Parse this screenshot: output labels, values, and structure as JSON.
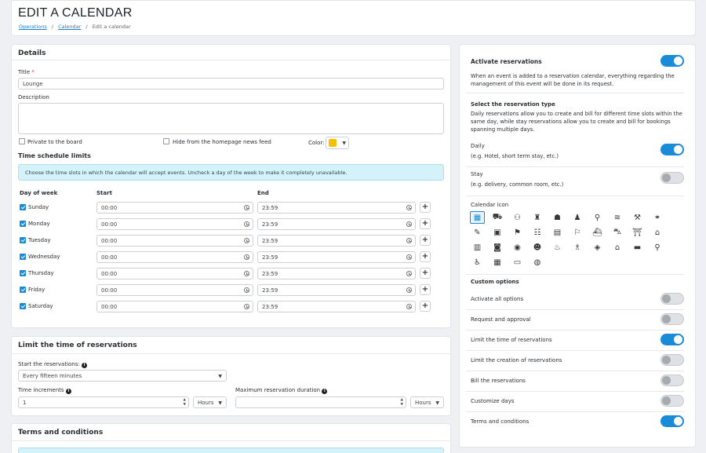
{
  "page": {
    "title": "EDIT A CALENDAR"
  },
  "breadcrumb": {
    "operations": "Operations",
    "calendar": "Calendar",
    "current": "Edit a calendar",
    "sep": "/"
  },
  "details": {
    "heading": "Details",
    "title_label": "Title",
    "required_mark": "*",
    "title_value": "Lounge",
    "description_label": "Description",
    "description_value": "",
    "private_label": "Private to the board",
    "hide_label": "Hide from the homepage news feed",
    "color_label": "Color:",
    "color_value": "#f6c000",
    "schedule_heading": "Time schedule limits",
    "schedule_info": "Choose the time slots in which the calendar will accept events. Uncheck a day of the week to make it completely unavailable.",
    "col_day": "Day of week",
    "col_start": "Start",
    "col_end": "End",
    "days": [
      {
        "name": "Sunday",
        "start": "00:00",
        "end": "23:59"
      },
      {
        "name": "Monday",
        "start": "00:00",
        "end": "23:59"
      },
      {
        "name": "Tuesday",
        "start": "00:00",
        "end": "23:59"
      },
      {
        "name": "Wednesday",
        "start": "00:00",
        "end": "23:59"
      },
      {
        "name": "Thursday",
        "start": "00:00",
        "end": "23:59"
      },
      {
        "name": "Friday",
        "start": "00:00",
        "end": "23:59"
      },
      {
        "name": "Saturday",
        "start": "00:00",
        "end": "23:59"
      }
    ],
    "plus": "+"
  },
  "limit": {
    "heading": "Limit the time of reservations",
    "start_label": "Start the reservations:",
    "start_value": "Every fifteen minutes",
    "increments_label": "Time increments",
    "increments_value": "1",
    "increments_unit": "Hours",
    "max_label": "Maximum reservation duration",
    "max_value": "",
    "max_unit": "Hours"
  },
  "terms": {
    "heading": "Terms and conditions"
  },
  "reservations": {
    "activate_label": "Activate reservations",
    "activate_on": true,
    "activate_desc": "When an event is added to a reservation calendar, everything regarding the management of this event will be done in its request.",
    "type_heading": "Select the reservation type",
    "type_desc": "Daily reservations allow you to create and bill for different time slots within the same day, while stay reservations allow you to create and bill for bookings spanning multiple days.",
    "daily_label": "Daily",
    "daily_sub": "(e.g. Hotel, short term stay, etc.)",
    "daily_on": true,
    "stay_label": "Stay",
    "stay_sub": "(e.g. delivery, common room, etc.)",
    "stay_on": false,
    "icon_heading": "Calendar icon",
    "icons": [
      "calendar-check-icon",
      "truck-icon",
      "people-carry-icon",
      "person-luggage-icon",
      "concierge-icon",
      "bowling-icon",
      "running-icon",
      "swimmer-icon",
      "dumbbell-icon",
      "bicycle-icon",
      "book-reader-icon",
      "box-icon",
      "gift-icon",
      "clipboard-list-icon",
      "clipboard-icon",
      "flag-icon",
      "dolly-icon",
      "car-icon",
      "torii-gate-icon",
      "garage-car-icon",
      "parking-icon",
      "projector-icon",
      "binoculars-icon",
      "users-icon",
      "grill-icon",
      "birthday-cake-icon",
      "toys-icon",
      "home-icon",
      "bed-icon",
      "map-marker-icon",
      "wheelchair-icon",
      "warehouse-icon",
      "stage-icon",
      "gamepad-icon"
    ],
    "custom_heading": "Custom options",
    "options": [
      {
        "label": "Activate all options",
        "on": false
      },
      {
        "label": "Request and approval",
        "on": false
      },
      {
        "label": "Limit the time of reservations",
        "on": true
      },
      {
        "label": "Limit the creation of reservations",
        "on": false
      },
      {
        "label": "Bill the reservations",
        "on": false
      },
      {
        "label": "Customize days",
        "on": false
      },
      {
        "label": "Terms and conditions",
        "on": true
      }
    ],
    "accent": "#1a8bd6"
  }
}
